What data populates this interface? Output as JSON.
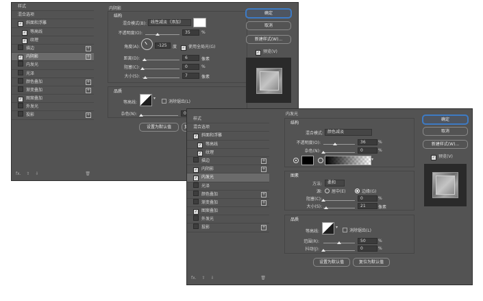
{
  "left_list": [
    {
      "label": "样式",
      "checkbox": "none",
      "plus": false,
      "sub": false,
      "selected": false
    },
    {
      "label": "混合选项",
      "checkbox": "none",
      "plus": false,
      "sub": false,
      "selected": false
    },
    {
      "label": "斜面和浮雕",
      "checkbox": "on",
      "plus": false,
      "sub": false,
      "selected": false
    },
    {
      "label": "等高线",
      "checkbox": "on",
      "plus": false,
      "sub": true,
      "selected": false
    },
    {
      "label": "纹理",
      "checkbox": "on",
      "plus": false,
      "sub": true,
      "selected": false
    },
    {
      "label": "描边",
      "checkbox": "off",
      "plus": true,
      "sub": false,
      "selected": false
    },
    {
      "label": "内阴影",
      "checkbox": "on",
      "plus": true,
      "sub": false,
      "selected": true
    },
    {
      "label": "内发光",
      "checkbox": "off",
      "plus": false,
      "sub": false,
      "selected": false
    },
    {
      "label": "光泽",
      "checkbox": "off",
      "plus": false,
      "sub": false,
      "selected": false
    },
    {
      "label": "颜色叠加",
      "checkbox": "off",
      "plus": true,
      "sub": false,
      "selected": false
    },
    {
      "label": "渐变叠加",
      "checkbox": "off",
      "plus": true,
      "sub": false,
      "selected": false
    },
    {
      "label": "图案叠加",
      "checkbox": "on",
      "plus": false,
      "sub": false,
      "selected": false
    },
    {
      "label": "外发光",
      "checkbox": "off",
      "plus": false,
      "sub": false,
      "selected": false
    },
    {
      "label": "投影",
      "checkbox": "off",
      "plus": true,
      "sub": false,
      "selected": false
    }
  ],
  "right_list": [
    {
      "label": "样式",
      "checkbox": "none",
      "plus": false,
      "sub": false,
      "selected": false
    },
    {
      "label": "混合选项",
      "checkbox": "none",
      "plus": false,
      "sub": false,
      "selected": false
    },
    {
      "label": "斜面和浮雕",
      "checkbox": "on",
      "plus": false,
      "sub": false,
      "selected": false
    },
    {
      "label": "等高线",
      "checkbox": "on",
      "plus": false,
      "sub": true,
      "selected": false
    },
    {
      "label": "纹理",
      "checkbox": "on",
      "plus": false,
      "sub": true,
      "selected": false
    },
    {
      "label": "描边",
      "checkbox": "off",
      "plus": true,
      "sub": false,
      "selected": false
    },
    {
      "label": "内阴影",
      "checkbox": "on",
      "plus": true,
      "sub": false,
      "selected": false
    },
    {
      "label": "内发光",
      "checkbox": "on",
      "plus": false,
      "sub": false,
      "selected": true
    },
    {
      "label": "光泽",
      "checkbox": "off",
      "plus": false,
      "sub": false,
      "selected": false
    },
    {
      "label": "颜色叠加",
      "checkbox": "off",
      "plus": true,
      "sub": false,
      "selected": false
    },
    {
      "label": "渐变叠加",
      "checkbox": "off",
      "plus": true,
      "sub": false,
      "selected": false
    },
    {
      "label": "图案叠加",
      "checkbox": "on",
      "plus": false,
      "sub": false,
      "selected": false
    },
    {
      "label": "外发光",
      "checkbox": "off",
      "plus": false,
      "sub": false,
      "selected": false
    },
    {
      "label": "投影",
      "checkbox": "off",
      "plus": true,
      "sub": false,
      "selected": false
    }
  ],
  "bottom": {
    "fx": "fx.",
    "up": "⇧",
    "down": "⇩",
    "trash": "🗑"
  },
  "check_mark": "✓",
  "plus_mark": "+",
  "inner_shadow": {
    "title": "内阴影",
    "structure": "结构",
    "blend_label": "混合模式(B):",
    "blend_value": "线性减淡（添加）",
    "opacity_label": "不透明度(O):",
    "opacity_value": "35",
    "opacity_level": 0.35,
    "percent": "%",
    "angle_label": "角度(A):",
    "angle_value": "-125",
    "degree": "度",
    "global_light": "使用全局光(G)",
    "distance_label": "距离(D):",
    "distance_value": "6",
    "distance_level": 0.06,
    "px": "像素",
    "choke_label": "阻塞(C):",
    "choke_value": "0",
    "choke_level": 0,
    "size_label": "大小(S):",
    "size_value": "7",
    "size_level": 0.07,
    "quality": "品质",
    "contour_label": "等高线:",
    "antialias": "消除锯齿(L)",
    "noise_label": "杂色(N):",
    "noise_value": "0",
    "noise_level": 0,
    "set_default": "设置为默认值",
    "reset_default": "复位"
  },
  "inner_glow": {
    "title": "内发光",
    "structure": "结构",
    "blend_label": "混合模式:",
    "blend_value": "颜色减淡",
    "opacity_label": "不透明度(O):",
    "opacity_value": "36",
    "opacity_level": 0.36,
    "percent": "%",
    "noise_label": "杂色(N):",
    "noise_value": "0",
    "noise_level": 0,
    "elements": "图素",
    "method_label": "方法:",
    "method_value": "柔和",
    "source_label": "源:",
    "center": "居中(E)",
    "edge": "边缘(G)",
    "choke_label": "阻塞(C):",
    "choke_value": "0",
    "choke_level": 0,
    "size_label": "大小(S):",
    "size_value": "21",
    "size_level": 0.084,
    "px": "像素",
    "quality": "品质",
    "contour_label": "等高线:",
    "antialias": "消除锯齿(L)",
    "range_label": "范围(R):",
    "range_value": "50",
    "range_level": 0.5,
    "jitter_label": "抖动(J):",
    "jitter_value": "0",
    "jitter_level": 0,
    "set_default": "设置为默认值",
    "reset_default": "复位为默认值"
  },
  "buttons": {
    "ok": "确定",
    "cancel": "取消",
    "new_style": "新建样式(W)...",
    "preview": "预览(V)"
  },
  "colors": {
    "dialog_bg": "#535353",
    "accent": "#3d7bc5",
    "selected_row": "#6b6b6b"
  }
}
